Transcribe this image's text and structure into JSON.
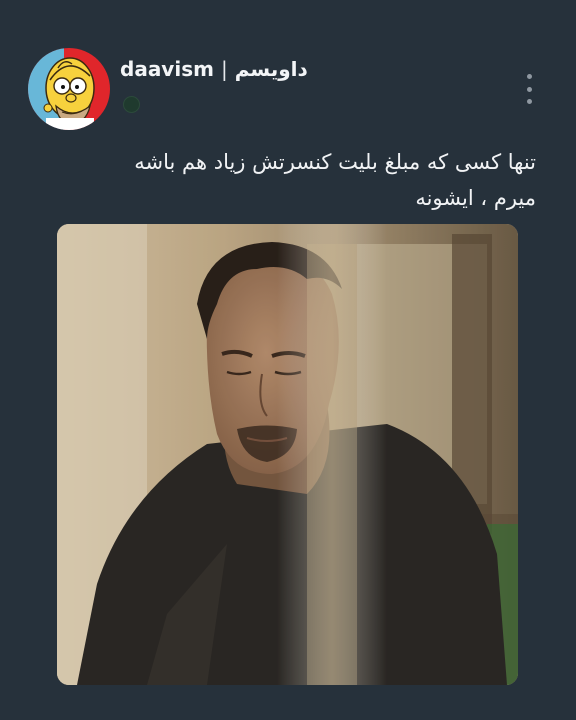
{
  "post": {
    "username": "daavism",
    "separator": "|",
    "display_name": "داویسم",
    "caption_lines": [
      "تنها کسی که مبلغ بلیت کنسرتش زیاد هم باشه",
      "میرم ، ایشونه"
    ],
    "avatar_icon": "cartoon-character-avatar-icon",
    "menu_icon": "vertical-ellipsis-icon",
    "photo_subject": "man-in-dark-tshirt-photo"
  },
  "colors": {
    "background": "#26313b",
    "text": "#f1f3f5",
    "avatar_bg": "#e0262b",
    "status_dot": "#1f3a2e",
    "menu_dots": "#8f98a1"
  }
}
